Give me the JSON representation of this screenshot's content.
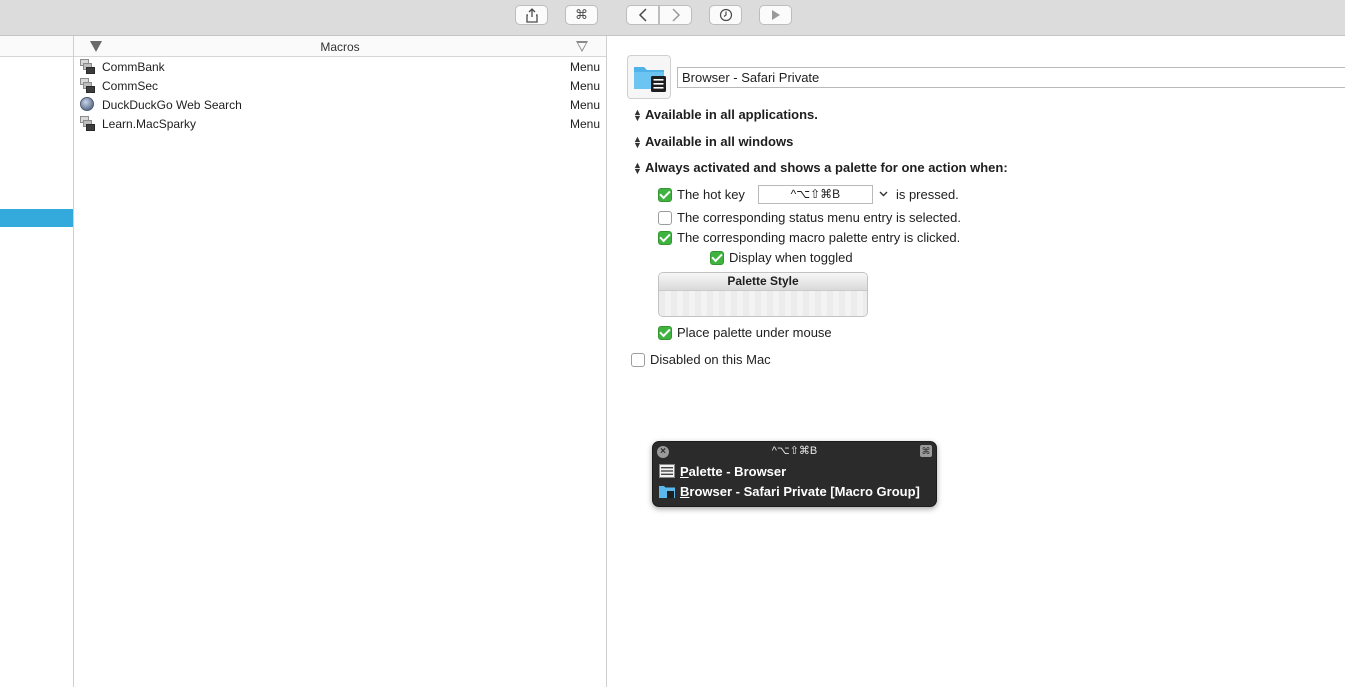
{
  "toolbar": {
    "cmd_glyph": "⌘"
  },
  "macros_list": {
    "header": "Macros",
    "rows": [
      {
        "name": "CommBank",
        "trigger": "Menu",
        "icon": "stack-icon"
      },
      {
        "name": "CommSec",
        "trigger": "Menu",
        "icon": "stack-icon"
      },
      {
        "name": "DuckDuckGo Web Search",
        "trigger": "Menu",
        "icon": "globe-icon"
      },
      {
        "name": "Learn.MacSparky",
        "trigger": "Menu",
        "icon": "stack-icon"
      }
    ]
  },
  "editor": {
    "group_name": "Browser - Safari Private",
    "availability_apps": "Available in all applications.",
    "availability_windows": "Available in all windows",
    "activation": "Always activated and shows a palette for one action when:",
    "hotkey": {
      "prefix": "The hot key",
      "value": "^⌥⇧⌘B",
      "suffix": "is pressed.",
      "checked": true
    },
    "status_menu": {
      "label": "The corresponding status menu entry is selected.",
      "checked": false
    },
    "palette_entry": {
      "label": "The corresponding macro palette entry is clicked.",
      "checked": true
    },
    "display_toggled": {
      "label": "Display when toggled",
      "checked": true
    },
    "palette_style_label": "Palette Style",
    "place_under_mouse": {
      "label": "Place palette under mouse",
      "checked": true
    },
    "disabled_mac": {
      "label": "Disabled on this Mac",
      "checked": false
    }
  },
  "palette": {
    "title": "^⌥⇧⌘B",
    "close_glyph": "×",
    "cmd_glyph": "⌘",
    "items": [
      {
        "first": "P",
        "rest": "alette - Browser"
      },
      {
        "first": "B",
        "rest": "rowser - Safari Private [Macro Group]"
      }
    ]
  },
  "colors": {
    "selection": "#33a9dc",
    "checkbox_on": "#3fb340",
    "palette_bg": "#2b2b2b",
    "toolbar_bg": "#dcdcdc"
  }
}
